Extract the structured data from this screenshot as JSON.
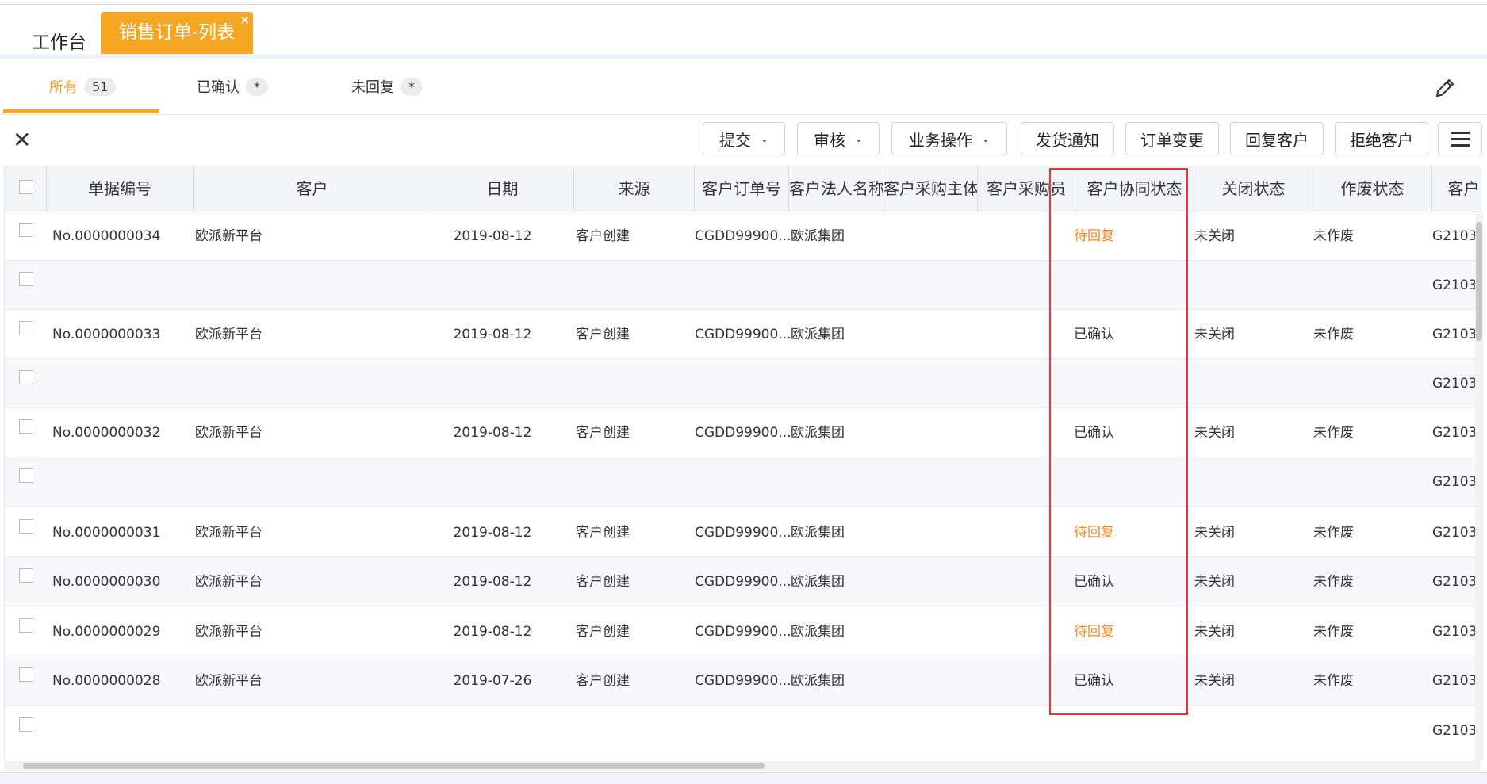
{
  "tabs": {
    "workbench": "工作台",
    "active": "销售订单-列表",
    "close_glyph": "×"
  },
  "filters": [
    {
      "label": "所有",
      "badge": "51",
      "active": true
    },
    {
      "label": "已确认",
      "badge": "*",
      "active": false
    },
    {
      "label": "未回复",
      "badge": "*",
      "active": false
    }
  ],
  "toolbar": {
    "close_glyph": "✕",
    "buttons": [
      {
        "label": "提交",
        "dropdown": true
      },
      {
        "label": "审核",
        "dropdown": true
      },
      {
        "label": "业务操作",
        "dropdown": true
      },
      {
        "label": "发货通知",
        "dropdown": false
      },
      {
        "label": "订单变更",
        "dropdown": false
      },
      {
        "label": "回复客户",
        "dropdown": false
      },
      {
        "label": "拒绝客户",
        "dropdown": false
      }
    ],
    "chevron_glyph": "⌄"
  },
  "columns": [
    "单据编号",
    "客户",
    "日期",
    "来源",
    "客户订单号",
    "客户法人名称",
    "客户采购主体",
    "客户采购员",
    "客户协同状态",
    "关闭状态",
    "作废状态",
    "客户"
  ],
  "rows": [
    {
      "no": "No.0000000034",
      "customer": "欧派新平台",
      "date": "2019-08-12",
      "source": "客户创建",
      "order": "CGDD99900...",
      "legal": "欧派集团",
      "status": "待回复",
      "pending": true,
      "closed": "未关闭",
      "void": "未作废",
      "code": "G2103"
    },
    {
      "no": "",
      "customer": "",
      "date": "",
      "source": "",
      "order": "",
      "legal": "",
      "status": "",
      "pending": false,
      "closed": "",
      "void": "",
      "code": "G2103"
    },
    {
      "no": "No.0000000033",
      "customer": "欧派新平台",
      "date": "2019-08-12",
      "source": "客户创建",
      "order": "CGDD99900...",
      "legal": "欧派集团",
      "status": "已确认",
      "pending": false,
      "closed": "未关闭",
      "void": "未作废",
      "code": "G2103"
    },
    {
      "no": "",
      "customer": "",
      "date": "",
      "source": "",
      "order": "",
      "legal": "",
      "status": "",
      "pending": false,
      "closed": "",
      "void": "",
      "code": "G2103"
    },
    {
      "no": "No.0000000032",
      "customer": "欧派新平台",
      "date": "2019-08-12",
      "source": "客户创建",
      "order": "CGDD99900...",
      "legal": "欧派集团",
      "status": "已确认",
      "pending": false,
      "closed": "未关闭",
      "void": "未作废",
      "code": "G2103"
    },
    {
      "no": "",
      "customer": "",
      "date": "",
      "source": "",
      "order": "",
      "legal": "",
      "status": "",
      "pending": false,
      "closed": "",
      "void": "",
      "code": "G2103"
    },
    {
      "no": "No.0000000031",
      "customer": "欧派新平台",
      "date": "2019-08-12",
      "source": "客户创建",
      "order": "CGDD99900...",
      "legal": "欧派集团",
      "status": "待回复",
      "pending": true,
      "closed": "未关闭",
      "void": "未作废",
      "code": "G2103"
    },
    {
      "no": "No.0000000030",
      "customer": "欧派新平台",
      "date": "2019-08-12",
      "source": "客户创建",
      "order": "CGDD99900...",
      "legal": "欧派集团",
      "status": "已确认",
      "pending": false,
      "closed": "未关闭",
      "void": "未作废",
      "code": "G2103"
    },
    {
      "no": "No.0000000029",
      "customer": "欧派新平台",
      "date": "2019-08-12",
      "source": "客户创建",
      "order": "CGDD99900...",
      "legal": "欧派集团",
      "status": "待回复",
      "pending": true,
      "closed": "未关闭",
      "void": "未作废",
      "code": "G2103"
    },
    {
      "no": "No.0000000028",
      "customer": "欧派新平台",
      "date": "2019-07-26",
      "source": "客户创建",
      "order": "CGDD99900...",
      "legal": "欧派集团",
      "status": "已确认",
      "pending": false,
      "closed": "未关闭",
      "void": "未作废",
      "code": "G2103"
    },
    {
      "no": "",
      "customer": "",
      "date": "",
      "source": "",
      "order": "",
      "legal": "",
      "status": "",
      "pending": false,
      "closed": "",
      "void": "",
      "code": "G2103"
    }
  ],
  "colors": {
    "accent": "#f5a623",
    "pending": "#f08a24",
    "highlight": "#e33333"
  }
}
